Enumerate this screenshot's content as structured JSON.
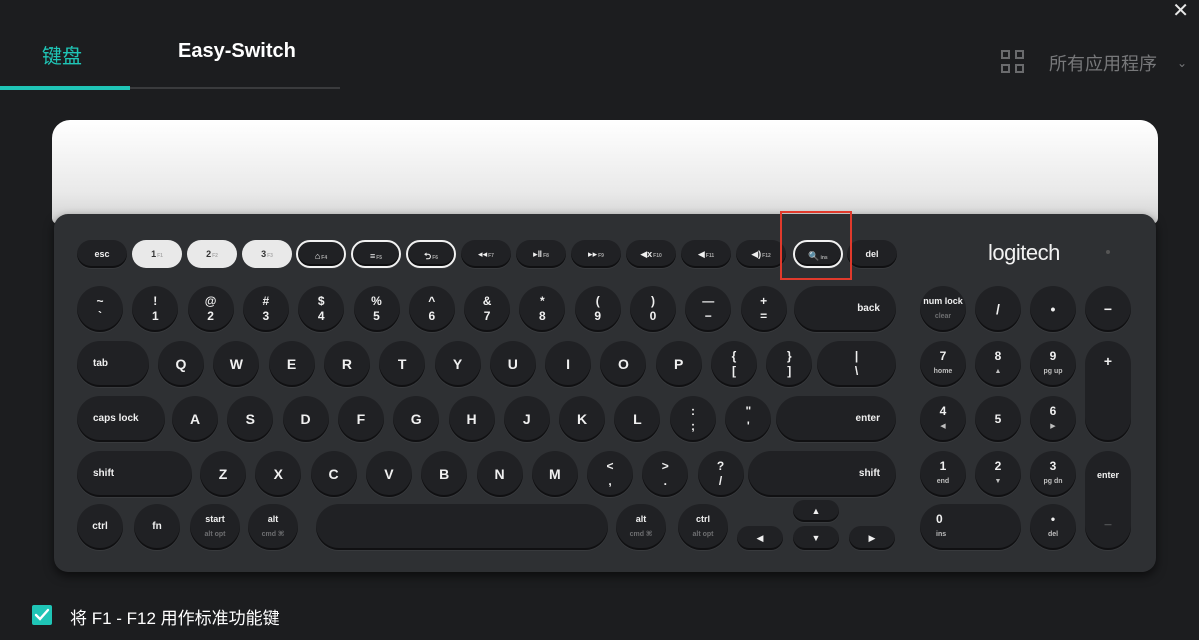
{
  "window": {
    "close": "✕"
  },
  "tabs": [
    {
      "label": "键盘",
      "active": true
    },
    {
      "label": "Easy-Switch",
      "active": false
    }
  ],
  "apps": {
    "label": "所有应用程序",
    "icon": "grid-icon"
  },
  "keyboard": {
    "logo": "logitech",
    "fn_row": [
      {
        "main": "esc",
        "sub": "",
        "style": "dark"
      },
      {
        "main": "1",
        "sub": "F1",
        "style": "white"
      },
      {
        "main": "2",
        "sub": "F2",
        "style": "white"
      },
      {
        "main": "3",
        "sub": "F3",
        "style": "white"
      },
      {
        "main": "⌂",
        "sub": "F4",
        "style": "outline"
      },
      {
        "main": "≡",
        "sub": "F5",
        "style": "outline"
      },
      {
        "main": "⮌",
        "sub": "F6",
        "style": "outline"
      },
      {
        "main": "◂◂",
        "sub": "F7",
        "style": "dark"
      },
      {
        "main": "▸‖",
        "sub": "F8",
        "style": "dark"
      },
      {
        "main": "▸▸",
        "sub": "F9",
        "style": "dark"
      },
      {
        "main": "◀x",
        "sub": "F10",
        "style": "dark"
      },
      {
        "main": "◀",
        "sub": "F11",
        "style": "dark"
      },
      {
        "main": "◀)",
        "sub": "F12",
        "style": "dark"
      },
      {
        "main": "🔍",
        "sub": "ins",
        "style": "outline"
      },
      {
        "main": "del",
        "sub": "",
        "style": "dark"
      }
    ],
    "number_row": [
      {
        "top": "~",
        "bottom": "`"
      },
      {
        "top": "!",
        "bottom": "1"
      },
      {
        "top": "@",
        "bottom": "2"
      },
      {
        "top": "#",
        "bottom": "3"
      },
      {
        "top": "$",
        "bottom": "4"
      },
      {
        "top": "%",
        "bottom": "5"
      },
      {
        "top": "^",
        "bottom": "6"
      },
      {
        "top": "&",
        "bottom": "7"
      },
      {
        "top": "*",
        "bottom": "8"
      },
      {
        "top": "(",
        "bottom": "9"
      },
      {
        "top": ")",
        "bottom": "0"
      },
      {
        "top": "—",
        "bottom": "−"
      },
      {
        "top": "+",
        "bottom": "="
      }
    ],
    "backspace": "back",
    "tab": "tab",
    "qwerty_row": [
      "Q",
      "W",
      "E",
      "R",
      "T",
      "Y",
      "U",
      "I",
      "O",
      "P"
    ],
    "bracket_keys": [
      {
        "top": "{",
        "bottom": "["
      },
      {
        "top": "}",
        "bottom": "]"
      },
      {
        "top": "|",
        "bottom": "\\"
      }
    ],
    "capslock": "caps lock",
    "home_row": [
      "A",
      "S",
      "D",
      "F",
      "G",
      "H",
      "J",
      "K",
      "L"
    ],
    "home_punct": [
      {
        "top": ":",
        "bottom": ";"
      },
      {
        "top": "\"",
        "bottom": "'"
      }
    ],
    "enter": "enter",
    "shift_left": "shift",
    "bottom_letters": [
      "Z",
      "X",
      "C",
      "V",
      "B",
      "N",
      "M"
    ],
    "bottom_punct": [
      {
        "top": "<",
        "bottom": ","
      },
      {
        "top": ">",
        "bottom": "."
      },
      {
        "top": "?",
        "bottom": "/"
      }
    ],
    "shift_right": "shift",
    "ctrl_left": "ctrl",
    "fn": "fn",
    "start": {
      "main": "start",
      "alt": "alt opt"
    },
    "alt_left": {
      "main": "alt",
      "alt": "cmd ⌘"
    },
    "alt_right": {
      "main": "alt",
      "alt": "cmd ⌘"
    },
    "ctrl_right": {
      "main": "ctrl",
      "alt": "alt opt"
    },
    "arrows": {
      "up": "▲",
      "left": "◀",
      "down": "▼",
      "right": "▶"
    },
    "numpad": {
      "numlock": {
        "main": "num lock",
        "alt": "clear"
      },
      "div": "/",
      "mul": "•",
      "minus": "−",
      "plus": "+",
      "n7": {
        "main": "7",
        "sub": "home"
      },
      "n8": {
        "main": "8",
        "sub": "▲"
      },
      "n9": {
        "main": "9",
        "sub": "pg up"
      },
      "n4": {
        "main": "4",
        "sub": "◀"
      },
      "n5": {
        "main": "5",
        "sub": ""
      },
      "n6": {
        "main": "6",
        "sub": "▶"
      },
      "n1": {
        "main": "1",
        "sub": "end"
      },
      "n2": {
        "main": "2",
        "sub": "▼"
      },
      "n3": {
        "main": "3",
        "sub": "pg dn"
      },
      "n0": {
        "main": "0",
        "sub": "ins"
      },
      "dot": {
        "main": "•",
        "sub": "del"
      },
      "enter": "enter",
      "enter_sub": "—"
    }
  },
  "option": {
    "checked": true,
    "label": "将 F1 - F12 用作标准功能键"
  },
  "colors": {
    "accent": "#1fc5b6",
    "highlight": "#e13a2c",
    "background": "#1c1d1f"
  }
}
